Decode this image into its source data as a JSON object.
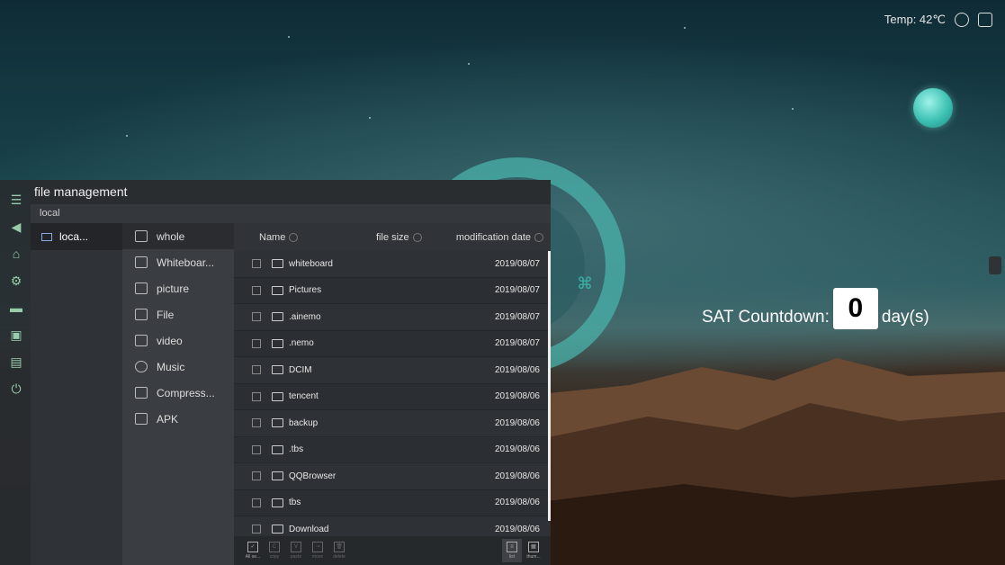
{
  "status": {
    "temp": "Temp: 42℃"
  },
  "countdown": {
    "label": "SAT Countdown:",
    "value": "0",
    "unit": "day(s)"
  },
  "window": {
    "title": "file management",
    "location": "local"
  },
  "storage": {
    "label": "loca..."
  },
  "categories": [
    "whole",
    "Whiteboar...",
    "picture",
    "File",
    "video",
    "Music",
    "Compress...",
    "APK"
  ],
  "columns": {
    "name": "Name",
    "size": "file size",
    "date": "modification date"
  },
  "files": [
    {
      "name": "whiteboard",
      "date": "2019/08/07"
    },
    {
      "name": "Pictures",
      "date": "2019/08/07"
    },
    {
      "name": ".ainemo",
      "date": "2019/08/07"
    },
    {
      "name": ".nemo",
      "date": "2019/08/07"
    },
    {
      "name": "DCIM",
      "date": "2019/08/06"
    },
    {
      "name": "tencent",
      "date": "2019/08/06"
    },
    {
      "name": "backup",
      "date": "2019/08/06"
    },
    {
      "name": ".tbs",
      "date": "2019/08/06"
    },
    {
      "name": "QQBrowser",
      "date": "2019/08/06"
    },
    {
      "name": "tbs",
      "date": "2019/08/06"
    },
    {
      "name": "Download",
      "date": "2019/08/06"
    }
  ],
  "toolbar": {
    "all": "All se...",
    "copy": "copy",
    "paste": "paste",
    "move": "move",
    "delete": "delete",
    "list": "list",
    "thumb": "thum..."
  }
}
